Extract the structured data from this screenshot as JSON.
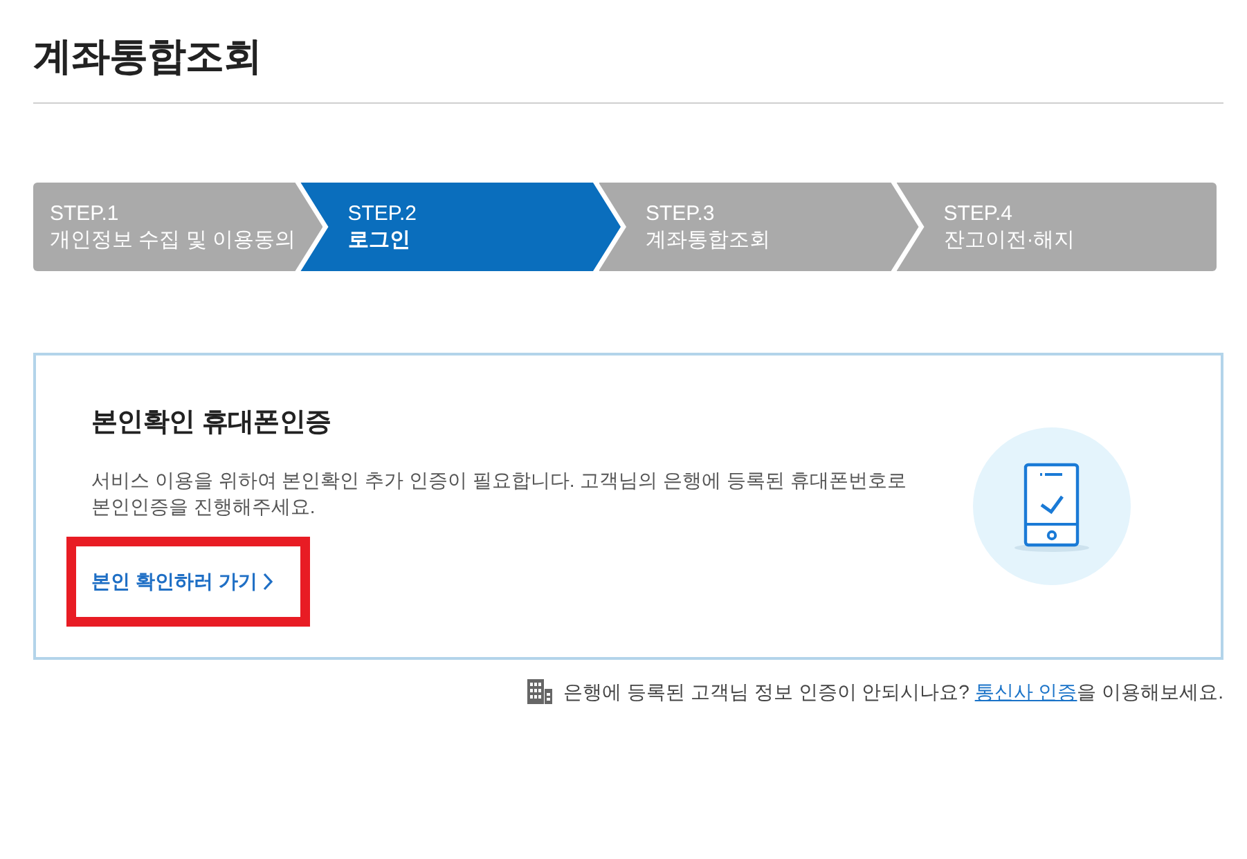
{
  "page": {
    "title": "계좌통합조회"
  },
  "steps": [
    {
      "number": "STEP.1",
      "label": "개인정보 수집 및 이용동의",
      "selected": false
    },
    {
      "number": "STEP.2",
      "label": "로그인",
      "selected": true
    },
    {
      "number": "STEP.3",
      "label": "계좌통합조회",
      "selected": false
    },
    {
      "number": "STEP.4",
      "label": "잔고이전·해지",
      "selected": false
    }
  ],
  "card": {
    "heading": "본인확인 휴대폰인증",
    "description_lines": [
      "서비스 이용을 위하여 본인확인 추가 인증이 필요합니다. 고객님의 은행에 등록된 휴대폰번호로",
      "본인인증을 진행해주세요."
    ],
    "link": {
      "label": "본인 확인하러 가기",
      "highlighted": true
    }
  },
  "note": {
    "text_before": "은행에 등록된 고객님 정보 인증이 안되시나요? ",
    "link": "통신사 인증",
    "text_after": "을 이용해보세요."
  }
}
